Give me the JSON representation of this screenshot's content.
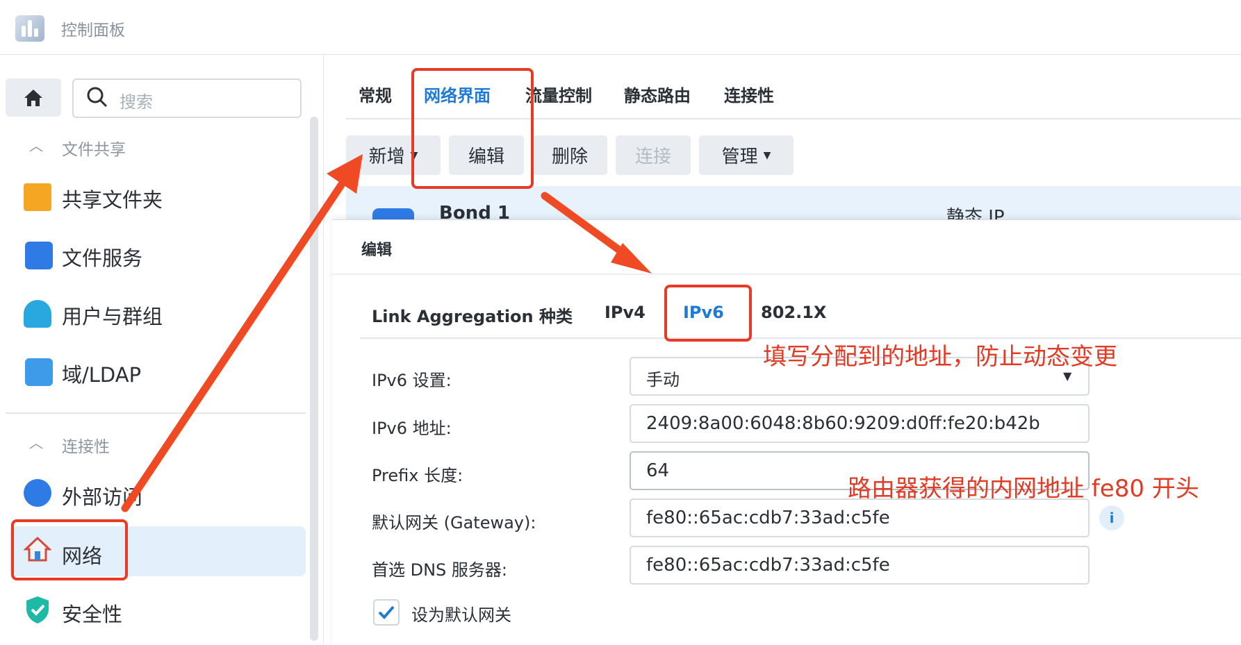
{
  "window": {
    "title": "控制面板"
  },
  "search": {
    "placeholder": "搜索"
  },
  "sidebar": {
    "sections": [
      {
        "label": "文件共享",
        "items": [
          {
            "label": "共享文件夹",
            "icon": "folder-icon"
          },
          {
            "label": "文件服务",
            "icon": "file-services-icon"
          },
          {
            "label": "用户与群组",
            "icon": "users-icon"
          },
          {
            "label": "域/LDAP",
            "icon": "ldap-icon"
          }
        ]
      },
      {
        "label": "连接性",
        "items": [
          {
            "label": "外部访问",
            "icon": "external-access-icon"
          },
          {
            "label": "网络",
            "icon": "network-house-icon",
            "selected": true
          },
          {
            "label": "安全性",
            "icon": "shield-icon"
          }
        ]
      }
    ]
  },
  "tabs": [
    {
      "label": "常规"
    },
    {
      "label": "网络界面",
      "active": true
    },
    {
      "label": "流量控制"
    },
    {
      "label": "静态路由"
    },
    {
      "label": "连接性"
    }
  ],
  "toolbar": {
    "add": "新增",
    "edit": "编辑",
    "delete": "删除",
    "connect": "连接",
    "manage": "管理"
  },
  "interface_row": {
    "name": "Bond 1",
    "type": "静态 IP"
  },
  "dialog": {
    "title": "编辑",
    "tabs": [
      {
        "label": "Link Aggregation 种类"
      },
      {
        "label": "IPv4"
      },
      {
        "label": "IPv6",
        "active": true
      },
      {
        "label": "802.1X"
      }
    ],
    "fields": {
      "ipv6_setting": {
        "label": "IPv6 设置:",
        "value": "手动"
      },
      "ipv6_address": {
        "label": "IPv6 地址:",
        "value": "2409:8a00:6048:8b60:9209:d0ff:fe20:b42b"
      },
      "prefix": {
        "label": "Prefix 长度:",
        "value": "64"
      },
      "gateway": {
        "label": "默认网关 (Gateway):",
        "value": "fe80::65ac:cdb7:33ad:c5fe"
      },
      "dns": {
        "label": "首选 DNS 服务器:",
        "value": "fe80::65ac:cdb7:33ad:c5fe"
      }
    },
    "default_gateway_checkbox": {
      "label": "设为默认网关",
      "checked": true
    }
  },
  "annotations": {
    "note_address": "填写分配到的地址，防止动态变更",
    "note_gateway": "路由器获得的内网地址 fe80 开头",
    "color": "#e83a24"
  }
}
